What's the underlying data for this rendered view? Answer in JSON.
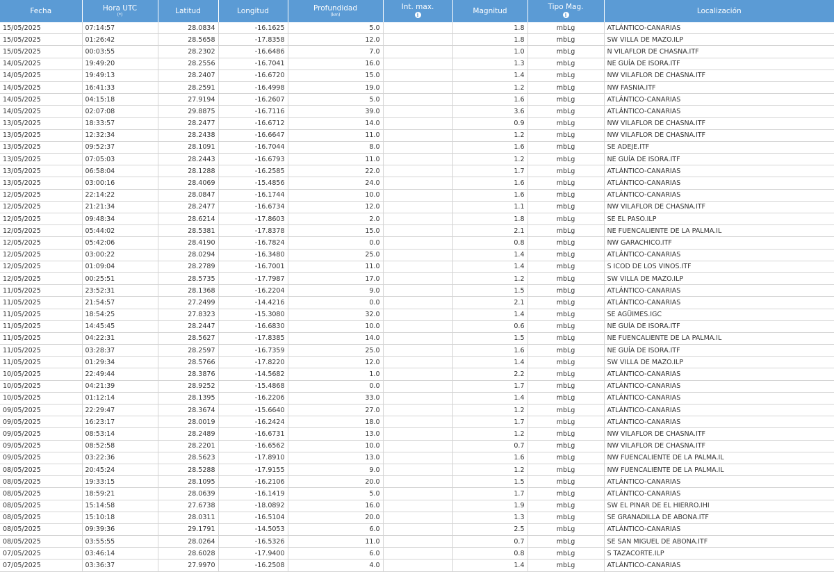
{
  "header": {
    "fecha": "Fecha",
    "hora": "Hora UTC",
    "hora_sub": "(*)",
    "latitud": "Latitud",
    "longitud": "Longitud",
    "profundidad": "Profundidad",
    "profundidad_sub": "(km)",
    "int_max": "Int. max.",
    "magnitud": "Magnitud",
    "tipo_mag": "Tipo Mag.",
    "localizacion": "Localización",
    "info_glyph": "i"
  },
  "rows": [
    {
      "fecha": "15/05/2025",
      "hora": "07:14:57",
      "lat": "28.0834",
      "lon": "-16.1625",
      "prof": "5.0",
      "int": "",
      "mag": "1.8",
      "tipo": "mbLg",
      "loc": "ATLÁNTICO-CANARIAS"
    },
    {
      "fecha": "15/05/2025",
      "hora": "01:26:42",
      "lat": "28.5658",
      "lon": "-17.8358",
      "prof": "12.0",
      "int": "",
      "mag": "1.8",
      "tipo": "mbLg",
      "loc": "SW VILLA DE MAZO.ILP"
    },
    {
      "fecha": "15/05/2025",
      "hora": "00:03:55",
      "lat": "28.2302",
      "lon": "-16.6486",
      "prof": "7.0",
      "int": "",
      "mag": "1.0",
      "tipo": "mbLg",
      "loc": "N VILAFLOR DE CHASNA.ITF"
    },
    {
      "fecha": "14/05/2025",
      "hora": "19:49:20",
      "lat": "28.2556",
      "lon": "-16.7041",
      "prof": "16.0",
      "int": "",
      "mag": "1.3",
      "tipo": "mbLg",
      "loc": "NE GUÍA DE ISORA.ITF"
    },
    {
      "fecha": "14/05/2025",
      "hora": "19:49:13",
      "lat": "28.2407",
      "lon": "-16.6720",
      "prof": "15.0",
      "int": "",
      "mag": "1.4",
      "tipo": "mbLg",
      "loc": "NW VILAFLOR DE CHASNA.ITF"
    },
    {
      "fecha": "14/05/2025",
      "hora": "16:41:33",
      "lat": "28.2591",
      "lon": "-16.4998",
      "prof": "19.0",
      "int": "",
      "mag": "1.2",
      "tipo": "mbLg",
      "loc": "NW FASNIA.ITF"
    },
    {
      "fecha": "14/05/2025",
      "hora": "04:15:18",
      "lat": "27.9194",
      "lon": "-16.2607",
      "prof": "5.0",
      "int": "",
      "mag": "1.6",
      "tipo": "mbLg",
      "loc": "ATLÁNTICO-CANARIAS"
    },
    {
      "fecha": "14/05/2025",
      "hora": "02:07:08",
      "lat": "29.8875",
      "lon": "-16.7116",
      "prof": "39.0",
      "int": "",
      "mag": "3.6",
      "tipo": "mbLg",
      "loc": "ATLÁNTICO-CANARIAS"
    },
    {
      "fecha": "13/05/2025",
      "hora": "18:33:57",
      "lat": "28.2477",
      "lon": "-16.6712",
      "prof": "14.0",
      "int": "",
      "mag": "0.9",
      "tipo": "mbLg",
      "loc": "NW VILAFLOR DE CHASNA.ITF"
    },
    {
      "fecha": "13/05/2025",
      "hora": "12:32:34",
      "lat": "28.2438",
      "lon": "-16.6647",
      "prof": "11.0",
      "int": "",
      "mag": "1.2",
      "tipo": "mbLg",
      "loc": "NW VILAFLOR DE CHASNA.ITF"
    },
    {
      "fecha": "13/05/2025",
      "hora": "09:52:37",
      "lat": "28.1091",
      "lon": "-16.7044",
      "prof": "8.0",
      "int": "",
      "mag": "1.6",
      "tipo": "mbLg",
      "loc": "SE ADEJE.ITF"
    },
    {
      "fecha": "13/05/2025",
      "hora": "07:05:03",
      "lat": "28.2443",
      "lon": "-16.6793",
      "prof": "11.0",
      "int": "",
      "mag": "1.2",
      "tipo": "mbLg",
      "loc": "NE GUÍA DE ISORA.ITF"
    },
    {
      "fecha": "13/05/2025",
      "hora": "06:58:04",
      "lat": "28.1288",
      "lon": "-16.2585",
      "prof": "22.0",
      "int": "",
      "mag": "1.7",
      "tipo": "mbLg",
      "loc": "ATLÁNTICO-CANARIAS"
    },
    {
      "fecha": "13/05/2025",
      "hora": "03:00:16",
      "lat": "28.4069",
      "lon": "-15.4856",
      "prof": "24.0",
      "int": "",
      "mag": "1.6",
      "tipo": "mbLg",
      "loc": "ATLÁNTICO-CANARIAS"
    },
    {
      "fecha": "12/05/2025",
      "hora": "22:14:22",
      "lat": "28.0847",
      "lon": "-16.1744",
      "prof": "10.0",
      "int": "",
      "mag": "1.6",
      "tipo": "mbLg",
      "loc": "ATLÁNTICO-CANARIAS"
    },
    {
      "fecha": "12/05/2025",
      "hora": "21:21:34",
      "lat": "28.2477",
      "lon": "-16.6734",
      "prof": "12.0",
      "int": "",
      "mag": "1.1",
      "tipo": "mbLg",
      "loc": "NW VILAFLOR DE CHASNA.ITF"
    },
    {
      "fecha": "12/05/2025",
      "hora": "09:48:34",
      "lat": "28.6214",
      "lon": "-17.8603",
      "prof": "2.0",
      "int": "",
      "mag": "1.8",
      "tipo": "mbLg",
      "loc": "SE EL PASO.ILP"
    },
    {
      "fecha": "12/05/2025",
      "hora": "05:44:02",
      "lat": "28.5381",
      "lon": "-17.8378",
      "prof": "15.0",
      "int": "",
      "mag": "2.1",
      "tipo": "mbLg",
      "loc": "NE FUENCALIENTE DE LA PALMA.IL"
    },
    {
      "fecha": "12/05/2025",
      "hora": "05:42:06",
      "lat": "28.4190",
      "lon": "-16.7824",
      "prof": "0.0",
      "int": "",
      "mag": "0.8",
      "tipo": "mbLg",
      "loc": "NW GARACHICO.ITF"
    },
    {
      "fecha": "12/05/2025",
      "hora": "03:00:22",
      "lat": "28.0294",
      "lon": "-16.3480",
      "prof": "25.0",
      "int": "",
      "mag": "1.4",
      "tipo": "mbLg",
      "loc": "ATLÁNTICO-CANARIAS"
    },
    {
      "fecha": "12/05/2025",
      "hora": "01:09:04",
      "lat": "28.2789",
      "lon": "-16.7001",
      "prof": "11.0",
      "int": "",
      "mag": "1.4",
      "tipo": "mbLg",
      "loc": "S ICOD DE LOS VINOS.ITF"
    },
    {
      "fecha": "12/05/2025",
      "hora": "00:25:51",
      "lat": "28.5735",
      "lon": "-17.7987",
      "prof": "17.0",
      "int": "",
      "mag": "1.2",
      "tipo": "mbLg",
      "loc": "SW VILLA DE MAZO.ILP"
    },
    {
      "fecha": "11/05/2025",
      "hora": "23:52:31",
      "lat": "28.1368",
      "lon": "-16.2204",
      "prof": "9.0",
      "int": "",
      "mag": "1.5",
      "tipo": "mbLg",
      "loc": "ATLÁNTICO-CANARIAS"
    },
    {
      "fecha": "11/05/2025",
      "hora": "21:54:57",
      "lat": "27.2499",
      "lon": "-14.4216",
      "prof": "0.0",
      "int": "",
      "mag": "2.1",
      "tipo": "mbLg",
      "loc": "ATLÁNTICO-CANARIAS"
    },
    {
      "fecha": "11/05/2025",
      "hora": "18:54:25",
      "lat": "27.8323",
      "lon": "-15.3080",
      "prof": "32.0",
      "int": "",
      "mag": "1.4",
      "tipo": "mbLg",
      "loc": "SE AGÜIMES.IGC"
    },
    {
      "fecha": "11/05/2025",
      "hora": "14:45:45",
      "lat": "28.2447",
      "lon": "-16.6830",
      "prof": "10.0",
      "int": "",
      "mag": "0.6",
      "tipo": "mbLg",
      "loc": "NE GUÍA DE ISORA.ITF"
    },
    {
      "fecha": "11/05/2025",
      "hora": "04:22:31",
      "lat": "28.5627",
      "lon": "-17.8385",
      "prof": "14.0",
      "int": "",
      "mag": "1.5",
      "tipo": "mbLg",
      "loc": "NE FUENCALIENTE DE LA PALMA.IL"
    },
    {
      "fecha": "11/05/2025",
      "hora": "03:28:37",
      "lat": "28.2597",
      "lon": "-16.7359",
      "prof": "25.0",
      "int": "",
      "mag": "1.6",
      "tipo": "mbLg",
      "loc": "NE GUÍA DE ISORA.ITF"
    },
    {
      "fecha": "11/05/2025",
      "hora": "01:29:34",
      "lat": "28.5766",
      "lon": "-17.8220",
      "prof": "12.0",
      "int": "",
      "mag": "1.4",
      "tipo": "mbLg",
      "loc": "SW VILLA DE MAZO.ILP"
    },
    {
      "fecha": "10/05/2025",
      "hora": "22:49:44",
      "lat": "28.3876",
      "lon": "-14.5682",
      "prof": "1.0",
      "int": "",
      "mag": "2.2",
      "tipo": "mbLg",
      "loc": "ATLÁNTICO-CANARIAS"
    },
    {
      "fecha": "10/05/2025",
      "hora": "04:21:39",
      "lat": "28.9252",
      "lon": "-15.4868",
      "prof": "0.0",
      "int": "",
      "mag": "1.7",
      "tipo": "mbLg",
      "loc": "ATLÁNTICO-CANARIAS"
    },
    {
      "fecha": "10/05/2025",
      "hora": "01:12:14",
      "lat": "28.1395",
      "lon": "-16.2206",
      "prof": "33.0",
      "int": "",
      "mag": "1.4",
      "tipo": "mbLg",
      "loc": "ATLÁNTICO-CANARIAS"
    },
    {
      "fecha": "09/05/2025",
      "hora": "22:29:47",
      "lat": "28.3674",
      "lon": "-15.6640",
      "prof": "27.0",
      "int": "",
      "mag": "1.2",
      "tipo": "mbLg",
      "loc": "ATLÁNTICO-CANARIAS"
    },
    {
      "fecha": "09/05/2025",
      "hora": "16:23:17",
      "lat": "28.0019",
      "lon": "-16.2424",
      "prof": "18.0",
      "int": "",
      "mag": "1.7",
      "tipo": "mbLg",
      "loc": "ATLÁNTICO-CANARIAS"
    },
    {
      "fecha": "09/05/2025",
      "hora": "08:53:14",
      "lat": "28.2489",
      "lon": "-16.6731",
      "prof": "13.0",
      "int": "",
      "mag": "1.2",
      "tipo": "mbLg",
      "loc": "NW VILAFLOR DE CHASNA.ITF"
    },
    {
      "fecha": "09/05/2025",
      "hora": "08:52:58",
      "lat": "28.2201",
      "lon": "-16.6562",
      "prof": "10.0",
      "int": "",
      "mag": "0.7",
      "tipo": "mbLg",
      "loc": "NW VILAFLOR DE CHASNA.ITF"
    },
    {
      "fecha": "09/05/2025",
      "hora": "03:22:36",
      "lat": "28.5623",
      "lon": "-17.8910",
      "prof": "13.0",
      "int": "",
      "mag": "1.6",
      "tipo": "mbLg",
      "loc": "NW FUENCALIENTE DE LA PALMA.IL"
    },
    {
      "fecha": "08/05/2025",
      "hora": "20:45:24",
      "lat": "28.5288",
      "lon": "-17.9155",
      "prof": "9.0",
      "int": "",
      "mag": "1.2",
      "tipo": "mbLg",
      "loc": "NW FUENCALIENTE DE LA PALMA.IL"
    },
    {
      "fecha": "08/05/2025",
      "hora": "19:33:15",
      "lat": "28.1095",
      "lon": "-16.2106",
      "prof": "20.0",
      "int": "",
      "mag": "1.5",
      "tipo": "mbLg",
      "loc": "ATLÁNTICO-CANARIAS"
    },
    {
      "fecha": "08/05/2025",
      "hora": "18:59:21",
      "lat": "28.0639",
      "lon": "-16.1419",
      "prof": "5.0",
      "int": "",
      "mag": "1.7",
      "tipo": "mbLg",
      "loc": "ATLÁNTICO-CANARIAS"
    },
    {
      "fecha": "08/05/2025",
      "hora": "15:14:58",
      "lat": "27.6738",
      "lon": "-18.0892",
      "prof": "16.0",
      "int": "",
      "mag": "1.9",
      "tipo": "mbLg",
      "loc": "SW EL PINAR DE EL HIERRO.IHI"
    },
    {
      "fecha": "08/05/2025",
      "hora": "15:10:18",
      "lat": "28.0311",
      "lon": "-16.5104",
      "prof": "20.0",
      "int": "",
      "mag": "1.3",
      "tipo": "mbLg",
      "loc": "SE GRANADILLA DE ABONA.ITF"
    },
    {
      "fecha": "08/05/2025",
      "hora": "09:39:36",
      "lat": "29.1791",
      "lon": "-14.5053",
      "prof": "6.0",
      "int": "",
      "mag": "2.5",
      "tipo": "mbLg",
      "loc": "ATLÁNTICO-CANARIAS"
    },
    {
      "fecha": "08/05/2025",
      "hora": "03:55:55",
      "lat": "28.0264",
      "lon": "-16.5326",
      "prof": "11.0",
      "int": "",
      "mag": "0.7",
      "tipo": "mbLg",
      "loc": "SE SAN MIGUEL DE ABONA.ITF"
    },
    {
      "fecha": "07/05/2025",
      "hora": "03:46:14",
      "lat": "28.6028",
      "lon": "-17.9400",
      "prof": "6.0",
      "int": "",
      "mag": "0.8",
      "tipo": "mbLg",
      "loc": "S TAZACORTE.ILP"
    },
    {
      "fecha": "07/05/2025",
      "hora": "03:36:37",
      "lat": "27.9970",
      "lon": "-16.2508",
      "prof": "4.0",
      "int": "",
      "mag": "1.4",
      "tipo": "mbLg",
      "loc": "ATLÁNTICO-CANARIAS"
    }
  ]
}
